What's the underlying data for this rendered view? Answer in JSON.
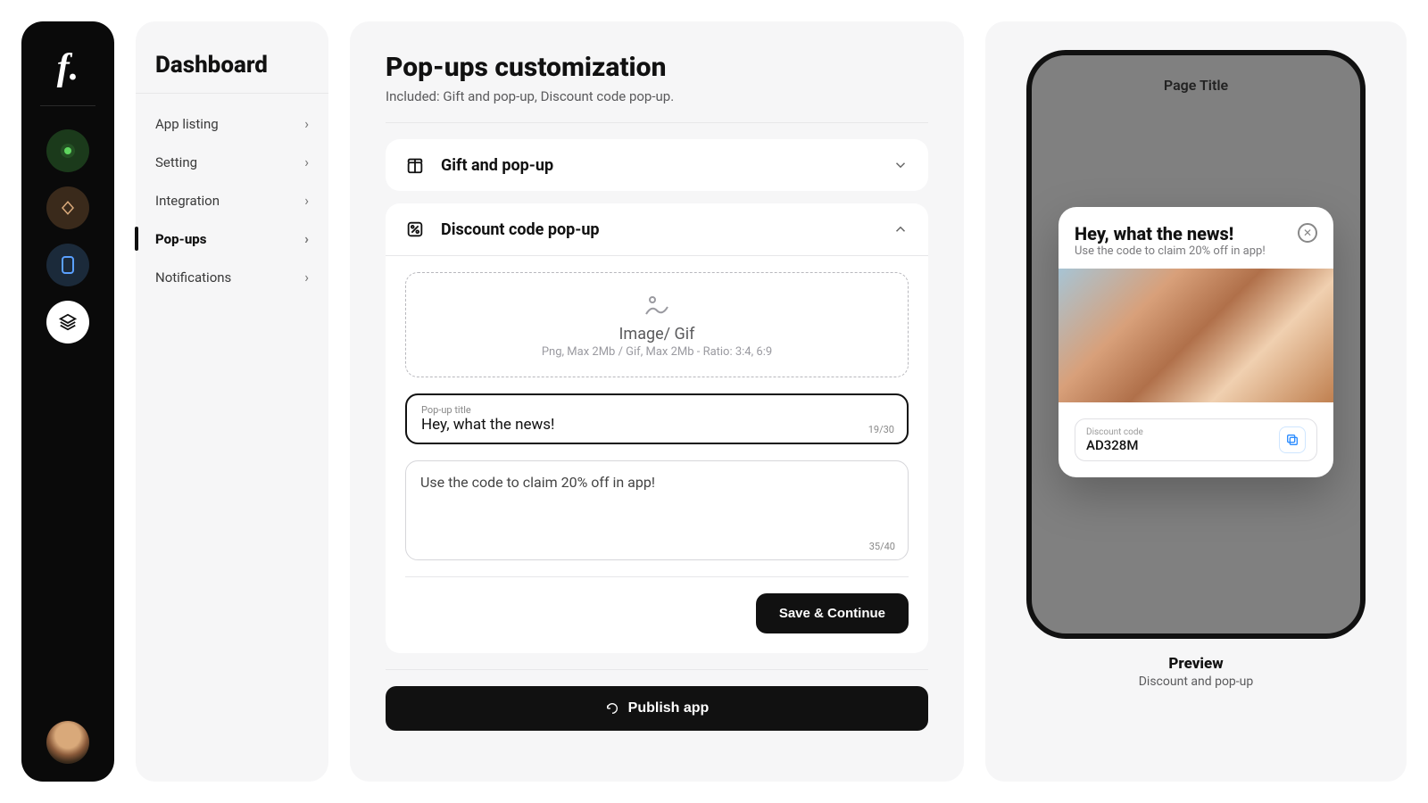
{
  "rail": {
    "logo": "f."
  },
  "sidebar": {
    "title": "Dashboard",
    "items": [
      {
        "label": "App listing"
      },
      {
        "label": "Setting"
      },
      {
        "label": "Integration"
      },
      {
        "label": "Pop-ups"
      },
      {
        "label": "Notifications"
      }
    ]
  },
  "main": {
    "title": "Pop-ups customization",
    "subtitle": "Included: Gift and pop-up, Discount code pop-up.",
    "section_gift_label": "Gift and pop-up",
    "section_discount_label": "Discount code pop-up",
    "dropzone_title": "Image/ Gif",
    "dropzone_sub": "Png, Max 2Mb / Gif, Max 2Mb - Ratio: 3:4, 6:9",
    "title_field_label": "Pop-up title",
    "title_field_value": "Hey, what the news!",
    "title_field_count": "19/30",
    "desc_value": "Use the code to claim 20% off in app!",
    "desc_count": "35/40",
    "save_label": "Save & Continue",
    "publish_label": "Publish app"
  },
  "preview": {
    "page_title": "Page Title",
    "popup_title": "Hey, what the news!",
    "popup_sub": "Use the code to claim 20% off in app!",
    "code_label": "Discount code",
    "code_value": "AD328M",
    "title": "Preview",
    "subtitle": "Discount and pop-up"
  }
}
